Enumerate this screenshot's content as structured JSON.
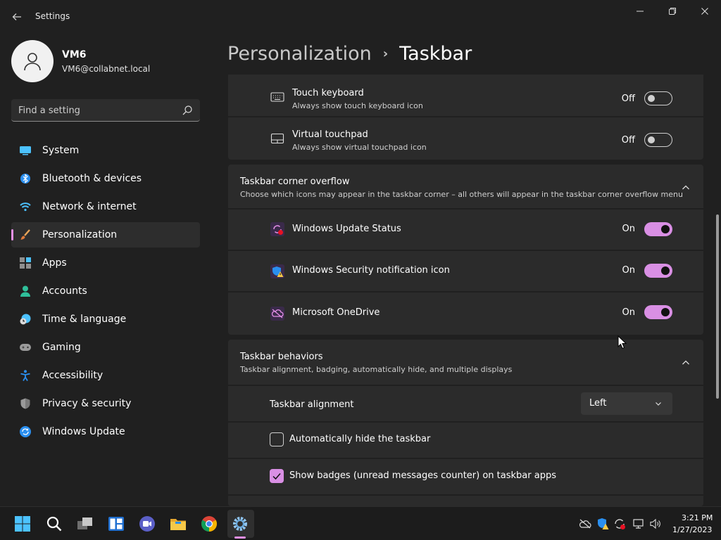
{
  "window": {
    "title": "Settings",
    "back_icon": "back-arrow-icon",
    "controls": [
      "minimize-icon",
      "maximize-icon",
      "close-icon"
    ]
  },
  "profile": {
    "name": "VM6",
    "email": "VM6@collabnet.local"
  },
  "search": {
    "placeholder": "Find a setting",
    "icon": "search-icon"
  },
  "nav": {
    "items": [
      {
        "label": "System",
        "icon": "system-icon"
      },
      {
        "label": "Bluetooth & devices",
        "icon": "bluetooth-icon"
      },
      {
        "label": "Network & internet",
        "icon": "wifi-icon"
      },
      {
        "label": "Personalization",
        "icon": "brush-icon",
        "active": true
      },
      {
        "label": "Apps",
        "icon": "apps-icon"
      },
      {
        "label": "Accounts",
        "icon": "person-icon"
      },
      {
        "label": "Time & language",
        "icon": "clock-globe-icon"
      },
      {
        "label": "Gaming",
        "icon": "gamepad-icon"
      },
      {
        "label": "Accessibility",
        "icon": "accessibility-icon"
      },
      {
        "label": "Privacy & security",
        "icon": "shield-icon"
      },
      {
        "label": "Windows Update",
        "icon": "update-icon"
      }
    ]
  },
  "header": {
    "parent": "Personalization",
    "separator": "›",
    "current": "Taskbar"
  },
  "pen_section": {
    "rows": [
      {
        "title": "Touch keyboard",
        "subtitle": "Always show touch keyboard icon",
        "state": "Off",
        "on": false,
        "icon": "keyboard-icon"
      },
      {
        "title": "Virtual touchpad",
        "subtitle": "Always show virtual touchpad icon",
        "state": "Off",
        "on": false,
        "icon": "touchpad-icon"
      }
    ]
  },
  "overflow_section": {
    "title": "Taskbar corner overflow",
    "subtitle": "Choose which icons may appear in the taskbar corner – all others will appear in the taskbar corner overflow menu",
    "rows": [
      {
        "title": "Windows Update Status",
        "state": "On",
        "on": true,
        "icon": "windows-update-status-icon"
      },
      {
        "title": "Windows Security notification icon",
        "state": "On",
        "on": true,
        "icon": "windows-security-warning-icon"
      },
      {
        "title": "Microsoft OneDrive",
        "state": "On",
        "on": true,
        "icon": "onedrive-off-icon"
      }
    ]
  },
  "behaviors_section": {
    "title": "Taskbar behaviors",
    "subtitle": "Taskbar alignment, badging, automatically hide, and multiple displays",
    "alignment_label": "Taskbar alignment",
    "alignment_value": "Left",
    "auto_hide_label": "Automatically hide the taskbar",
    "auto_hide_checked": false,
    "badges_label": "Show badges (unread messages counter) on taskbar apps",
    "badges_checked": true
  },
  "taskbar": {
    "apps": [
      "start-icon",
      "search-icon",
      "task-view-icon",
      "widgets-icon",
      "teams-chat-icon",
      "file-explorer-icon",
      "chrome-icon",
      "settings-icon"
    ],
    "active_app": "settings-icon",
    "tray": [
      "onedrive-off-icon",
      "windows-security-icon",
      "windows-update-icon",
      "network-icon",
      "volume-icon"
    ],
    "time": "3:21 PM",
    "date": "1/27/2023"
  },
  "colors": {
    "accent": "#d98fe4",
    "background": "#202020",
    "card": "#2b2b2b"
  }
}
